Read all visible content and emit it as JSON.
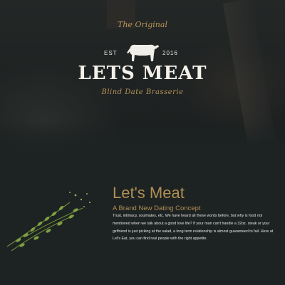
{
  "hero": {
    "logo": {
      "original": "The Original",
      "est": "EST",
      "year": "2016",
      "title": "LETS MEAT",
      "subtitle": "Blind Date Brasserie"
    }
  },
  "content": {
    "title": "Let's Meat",
    "subtitle": "A Brand New Dating Concept",
    "body": "Trust, intimacy, soulmates, etc. We have heard all these words before, but why is food not mentioned when we talk about a good love life? If your man can't handle a 32oz. steak or your girlfriend is just picking at the salad, a long term relationship is almost guaranteed to fail. Here at Let's Eat, you can find real people with the right appetite."
  },
  "colors": {
    "background": "#1d2222",
    "accent_gold": "#b08f55",
    "text_light": "#e6e6e2"
  },
  "icons": {
    "cow": "cow-icon",
    "herbs": "herb-sprig-image"
  }
}
